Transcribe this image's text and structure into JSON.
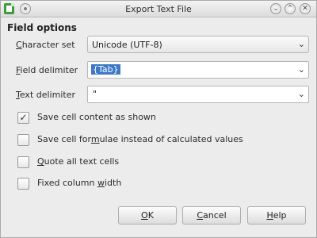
{
  "window": {
    "title": "Export Text File",
    "minimize_glyph": "⌄",
    "maximize_glyph": "⌃",
    "close_glyph": "✕"
  },
  "section": {
    "title": "Field options"
  },
  "fields": {
    "character_set": {
      "label_accel": "C",
      "label_rest": "haracter set",
      "value": "Unicode (UTF-8)"
    },
    "field_delimiter": {
      "label_accel": "F",
      "label_rest": "ield delimiter",
      "value": "{Tab}"
    },
    "text_delimiter": {
      "label_accel": "T",
      "label_rest": "ext delimiter",
      "value": "\""
    }
  },
  "checkboxes": [
    {
      "before": "Save cell content as shown",
      "accel": "",
      "after": "",
      "checked": true
    },
    {
      "before": "Save cell for",
      "accel": "m",
      "after": "ulae instead of calculated values",
      "checked": false
    },
    {
      "before": "",
      "accel": "Q",
      "after": "uote all text cells",
      "checked": false
    },
    {
      "before": "Fixed column ",
      "accel": "w",
      "after": "idth",
      "checked": false
    }
  ],
  "buttons": {
    "ok": {
      "accel": "O",
      "rest": "K"
    },
    "cancel": {
      "accel": "C",
      "rest": "ancel"
    },
    "help": {
      "accel": "H",
      "rest": "elp"
    }
  },
  "glyphs": {
    "dropdown": "⌄",
    "check": "✓"
  },
  "colors": {
    "selection": "#3d79c7",
    "app_icon": "#3f9b3a"
  }
}
